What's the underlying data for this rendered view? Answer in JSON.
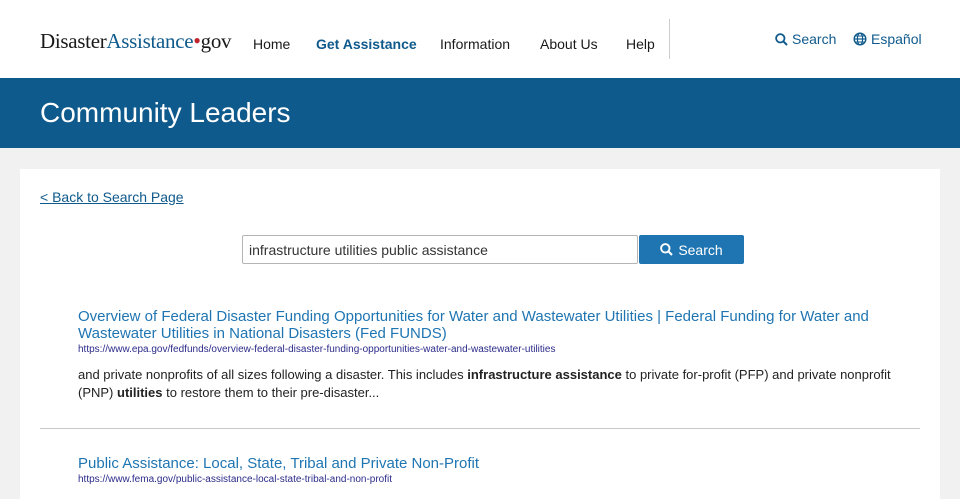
{
  "header": {
    "logo_part1": "Disaster",
    "logo_part2": "Assistance",
    "logo_dot": "•",
    "logo_part3": "gov",
    "nav": [
      {
        "label": "Home"
      },
      {
        "label": "Get Assistance",
        "active": true
      },
      {
        "label": "Information"
      },
      {
        "label": "About Us"
      },
      {
        "label": "Help"
      }
    ],
    "search_label": "Search",
    "search_icon": "search-icon",
    "language_label": "Español",
    "language_icon": "globe-icon"
  },
  "banner": {
    "title": "Community Leaders"
  },
  "content": {
    "back_link": "< Back to Search Page",
    "search": {
      "value": "infrastructure utilities public assistance",
      "button_label": "Search"
    },
    "results": [
      {
        "title": "Overview of Federal Disaster Funding Opportunities for Water and Wastewater Utilities | Federal Funding for Water and Wastewater Utilities in National Disasters (Fed FUNDS)",
        "url": "https://www.epa.gov/fedfunds/overview-federal-disaster-funding-opportunities-water-and-wastewater-utilities",
        "snippet": {
          "s1": "and private nonprofits of all sizes following a disaster. This includes ",
          "b1": "infrastructure assistance",
          "s2": " to private for-profit (PFP) and private nonprofit (PNP) ",
          "b2": "utilities",
          "s3": " to restore them to their pre-disaster..."
        }
      },
      {
        "title": "Public Assistance: Local, State, Tribal and Private Non-Profit",
        "url": "https://www.fema.gov/public-assistance-local-state-tribal-and-non-profit"
      }
    ]
  },
  "colors": {
    "brand_blue": "#0f5a8c",
    "link_blue": "#1f75b2",
    "button_blue": "#1f75b2",
    "logo_dot_red": "#c0242c"
  }
}
